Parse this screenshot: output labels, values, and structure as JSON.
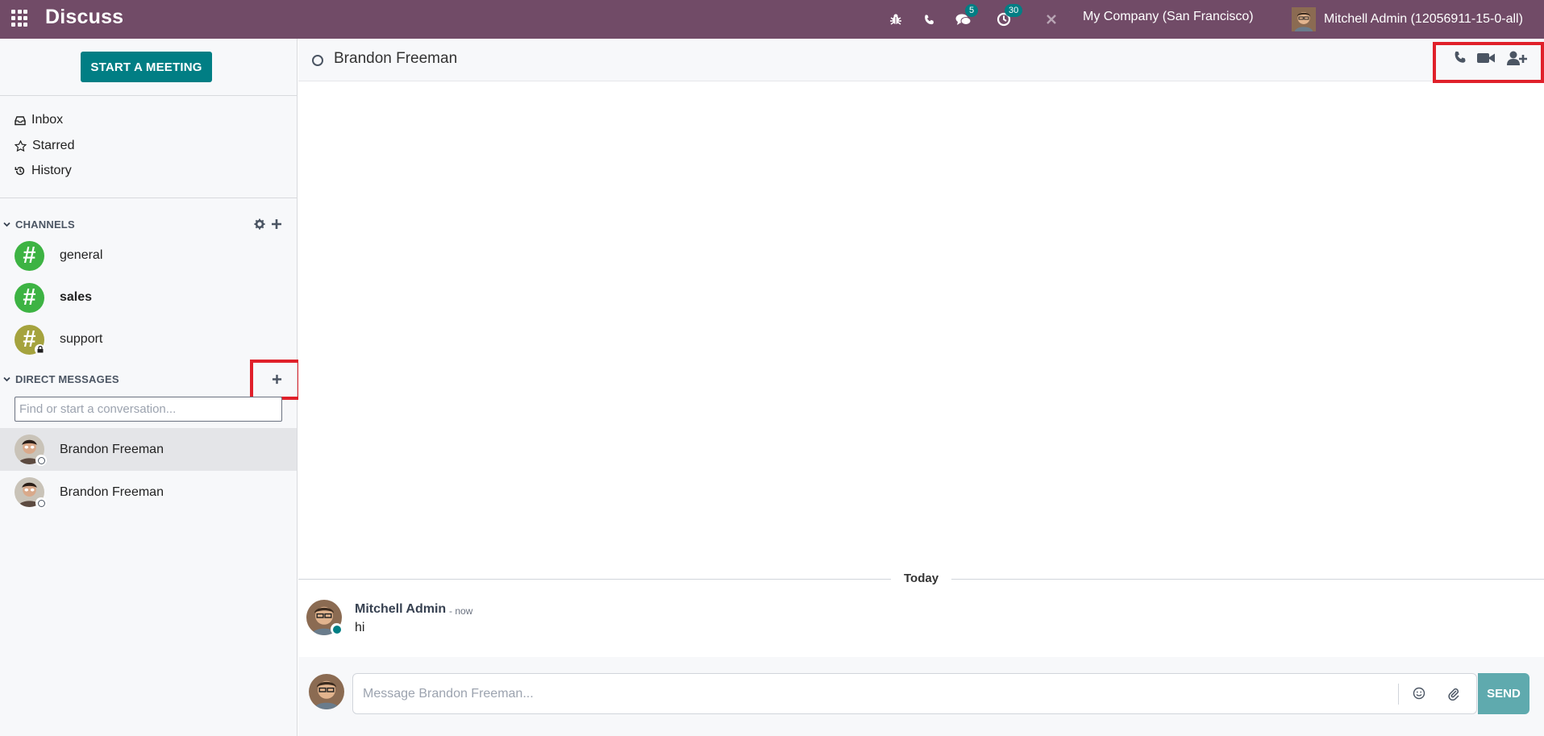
{
  "navbar": {
    "app_title": "Discuss",
    "messages_badge": "5",
    "activities_badge": "30",
    "company": "My Company (San Francisco)",
    "user_name": "Mitchell Admin (12056911-15-0-all)"
  },
  "sidebar": {
    "start_meeting_label": "START A MEETING",
    "mailboxes": [
      {
        "label": "Inbox",
        "icon": "inbox-icon"
      },
      {
        "label": "Starred",
        "icon": "star-icon"
      },
      {
        "label": "History",
        "icon": "history-icon"
      }
    ],
    "channels_title": "CHANNELS",
    "channels": [
      {
        "label": "general",
        "color": "#3DB343",
        "bold": false
      },
      {
        "label": "sales",
        "color": "#3DB343",
        "bold": true
      },
      {
        "label": "support",
        "color": "#A5A33E",
        "bold": false,
        "locked": true
      }
    ],
    "dm_title": "DIRECT MESSAGES",
    "dm_search_placeholder": "Find or start a conversation...",
    "direct_messages": [
      {
        "label": "Brandon Freeman",
        "active": true
      },
      {
        "label": "Brandon Freeman",
        "active": false
      }
    ]
  },
  "thread": {
    "name": "Brandon Freeman",
    "date_separator": "Today",
    "message": {
      "author": "Mitchell Admin",
      "time": "- now",
      "body": "hi"
    },
    "composer_placeholder": "Message Brandon Freeman...",
    "send_label": "SEND"
  },
  "colors": {
    "brand": "#714B67",
    "accent": "#017E84",
    "highlight": "#E0202A"
  }
}
